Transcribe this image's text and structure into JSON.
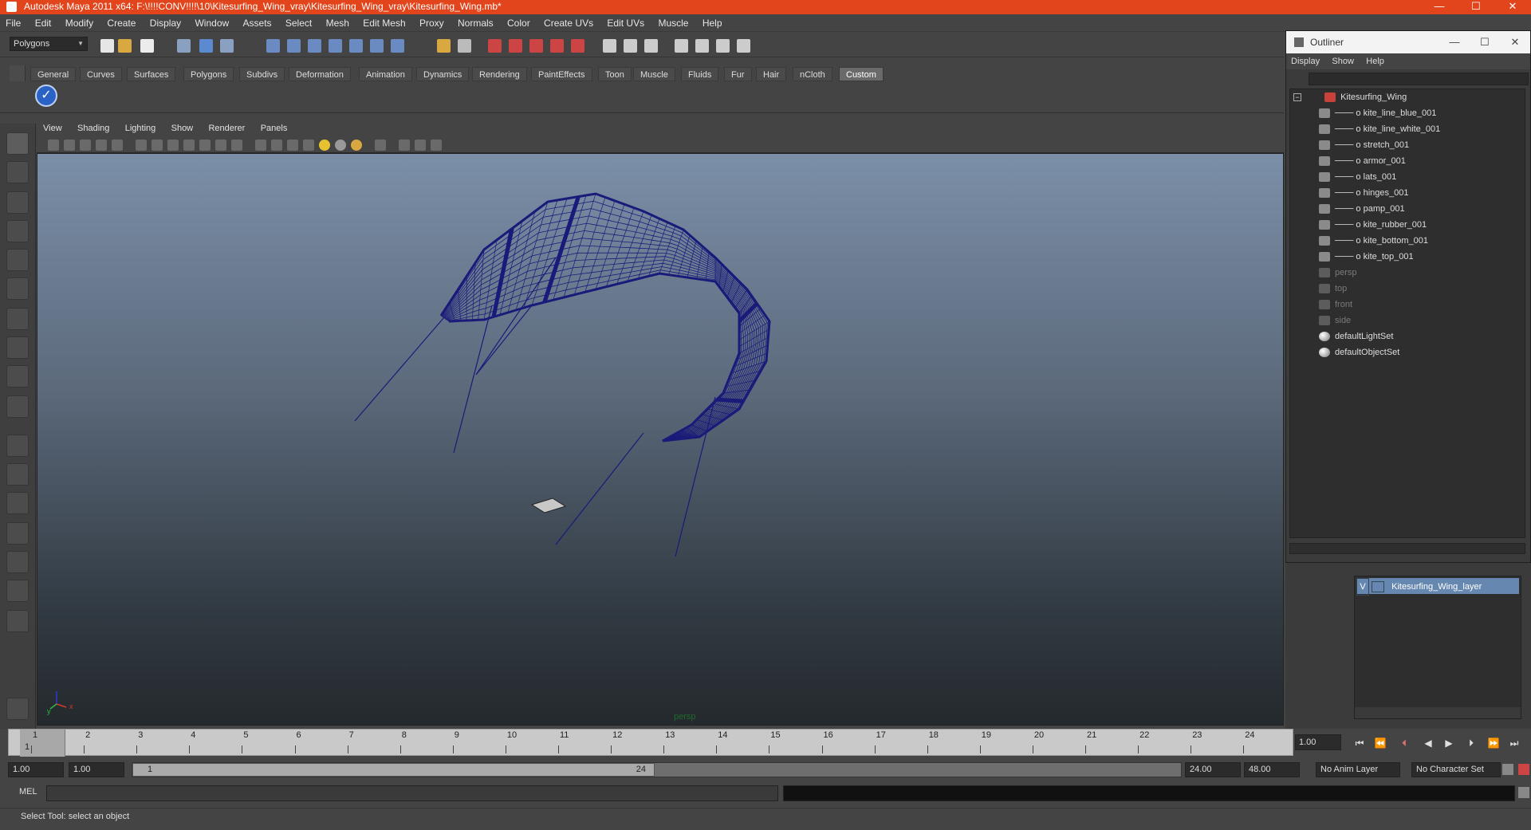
{
  "window": {
    "title": "Autodesk Maya 2011 x64: F:\\!!!!CONV!!!!\\10\\Kitesurfing_Wing_vray\\Kitesurfing_Wing_vray\\Kitesurfing_Wing.mb*",
    "minimize": "—",
    "maximize": "☐",
    "close": "✕"
  },
  "menubar": [
    "File",
    "Edit",
    "Modify",
    "Create",
    "Display",
    "Window",
    "Assets",
    "Select",
    "Mesh",
    "Edit Mesh",
    "Proxy",
    "Normals",
    "Color",
    "Create UVs",
    "Edit UVs",
    "Muscle",
    "Help"
  ],
  "toolbar": {
    "mode": "Polygons"
  },
  "shelf": {
    "tabs": [
      "General",
      "Curves",
      "Surfaces",
      "Polygons",
      "Subdivs",
      "Deformation",
      "Animation",
      "Dynamics",
      "Rendering",
      "PaintEffects",
      "Toon",
      "Muscle",
      "Fluids",
      "Fur",
      "Hair",
      "nCloth",
      "Custom"
    ],
    "active_tab": "Custom"
  },
  "viewport": {
    "menu": [
      "View",
      "Shading",
      "Lighting",
      "Show",
      "Renderer",
      "Panels"
    ],
    "camera_label": "persp",
    "wire_color": "#1a1a7a"
  },
  "timeline": {
    "ticks": [
      "1",
      "2",
      "3",
      "4",
      "5",
      "6",
      "7",
      "8",
      "9",
      "10",
      "11",
      "12",
      "13",
      "14",
      "15",
      "16",
      "17",
      "18",
      "19",
      "20",
      "21",
      "22",
      "23",
      "24"
    ],
    "current_frame": "1",
    "current_time": "1.00"
  },
  "range": {
    "start": "1.00",
    "playback_start": "1.00",
    "slider_start": "1",
    "slider_end": "24",
    "playback_end": "24.00",
    "end": "48.00",
    "anim_layer": "No Anim Layer",
    "character_set": "No Character Set"
  },
  "command_line": {
    "label": "MEL"
  },
  "status": {
    "help_text": "Select Tool: select an object"
  },
  "outliner": {
    "title": "Outliner",
    "menu": [
      "Display",
      "Show",
      "Help"
    ],
    "root": "Kitesurfing_Wing",
    "children": [
      "kite_line_blue_001",
      "kite_line_white_001",
      "stretch_001",
      "armor_001",
      "lats_001",
      "hinges_001",
      "pamp_001",
      "kite_rubber_001",
      "kite_bottom_001",
      "kite_top_001"
    ],
    "cameras": [
      "persp",
      "top",
      "front",
      "side"
    ],
    "sets": [
      "defaultLightSet",
      "defaultObjectSet"
    ]
  },
  "layers": {
    "visible": "V",
    "name": "Kitesurfing_Wing_layer"
  }
}
